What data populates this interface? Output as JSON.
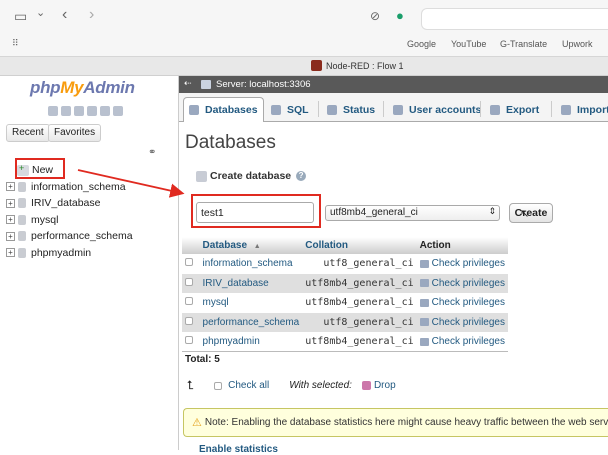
{
  "browser": {
    "bookmarks": [
      "Google",
      "YouTube",
      "G-Translate",
      "Upwork"
    ],
    "tab_title": "Node-RED : Flow 1"
  },
  "nav": {
    "logo_php": "php",
    "logo_my": "My",
    "logo_admin": "Admin",
    "btn_recent": "Recent",
    "btn_favorites": "Favorites",
    "new_label": "New",
    "databases": [
      "information_schema",
      "IRIV_database",
      "mysql",
      "performance_schema",
      "phpmyadmin"
    ]
  },
  "server": {
    "label": "Server: localhost:3306"
  },
  "tabs": [
    "Databases",
    "SQL",
    "Status",
    "User accounts",
    "Export",
    "Import"
  ],
  "page": {
    "title": "Databases"
  },
  "create": {
    "label": "Create database",
    "db_name_value": "test1",
    "collation_value": "utf8mb4_general_ci",
    "create_button": "Create"
  },
  "table": {
    "headers": {
      "database": "Database",
      "collation": "Collation",
      "action": "Action"
    },
    "sort_indicator": "▲",
    "rows": [
      {
        "name": "information_schema",
        "collation": "utf8_general_ci",
        "action": "Check privileges"
      },
      {
        "name": "IRIV_database",
        "collation": "utf8mb4_general_ci",
        "action": "Check privileges"
      },
      {
        "name": "mysql",
        "collation": "utf8mb4_general_ci",
        "action": "Check privileges"
      },
      {
        "name": "performance_schema",
        "collation": "utf8_general_ci",
        "action": "Check privileges"
      },
      {
        "name": "phpmyadmin",
        "collation": "utf8mb4_general_ci",
        "action": "Check privileges"
      }
    ],
    "total": "Total: 5"
  },
  "bulk": {
    "check_all": "Check all",
    "with_selected": "With selected:",
    "drop": "Drop"
  },
  "notice": {
    "text": "Note: Enabling the database statistics here might cause heavy traffic between the web server"
  },
  "enable_stats": "Enable statistics",
  "annotation_color": "#e02a20"
}
